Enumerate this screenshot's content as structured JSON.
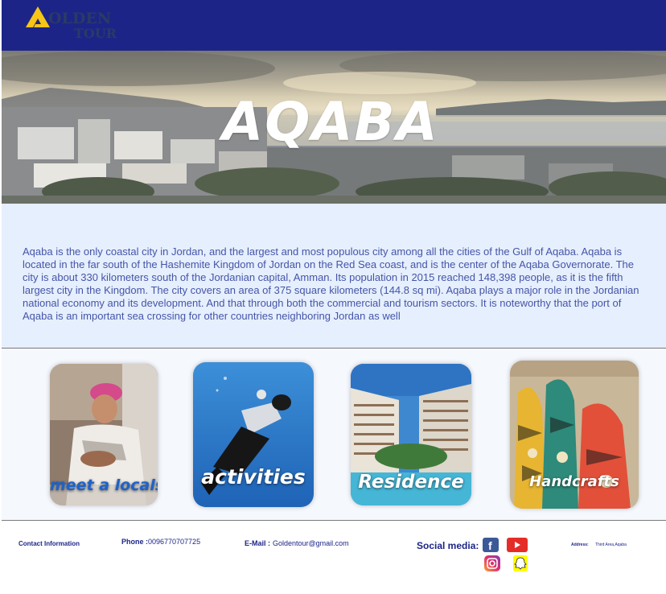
{
  "header": {
    "logo_word": "OLDEN",
    "logo_sub": "TOUR"
  },
  "hero": {
    "title": "AQABA"
  },
  "description": {
    "text": "Aqaba is the only coastal city in Jordan, and the largest and most populous city among all the cities of the Gulf of Aqaba. Aqaba is located in the far south of the Hashemite Kingdom of Jordan on the Red Sea coast, and is the center of the Aqaba Governorate. The city is about 330 kilometers south of the Jordanian capital, Amman. Its population in 2015 reached 148,398 people, as it is the fifth largest city in the Kingdom. The city covers an area of 375 square kilometers (144.8 sq mi). Aqaba plays a major role in the Jordanian national economy and its development. And that through both the commercial and tourism sectors. It is noteworthy that the port of Aqaba is an important sea crossing for other countries neighboring Jordan as well"
  },
  "cards": [
    {
      "label": "meet a locals"
    },
    {
      "label": "activities"
    },
    {
      "label": "Residence"
    },
    {
      "label": "Handcrafts"
    }
  ],
  "footer": {
    "contact_label": "Contact Information",
    "phone_label": "Phone :",
    "phone_value": "0096770707725",
    "email_label": "E-Mail :",
    "email_value": "Goldentour@gmail.com",
    "social_label": "Social media:",
    "address_label": "Address:",
    "address_value": "Third Area,Aqaba"
  },
  "icons": {
    "facebook": "facebook-icon",
    "youtube": "youtube-icon",
    "instagram": "instagram-icon",
    "snapchat": "snapchat-icon"
  },
  "colors": {
    "header_bg": "#1c2587",
    "logo_gold": "#f5c518",
    "description_bg": "#e6effd",
    "description_text": "#4555a8",
    "footer_text": "#1c2587"
  }
}
